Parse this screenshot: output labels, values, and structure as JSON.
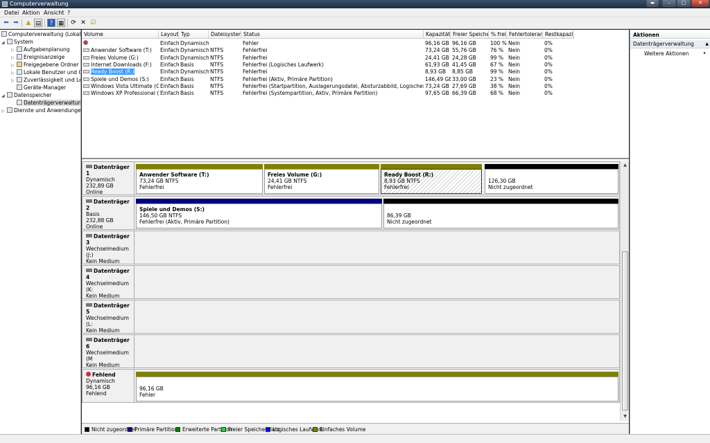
{
  "window": {
    "title": "Computerverwaltung"
  },
  "menu": [
    "Datei",
    "Aktion",
    "Ansicht",
    "?"
  ],
  "tree": {
    "root": "Computerverwaltung (Lokal)",
    "system": "System",
    "system_items": [
      "Aufgabenplanung",
      "Ereignisanzeige",
      "Freigegebene Ordner",
      "Lokale Benutzer und Gr",
      "Zuverlässigkeit und Leis",
      "Geräte-Manager"
    ],
    "storage": "Datenspeicher",
    "storage_items": [
      "Datenträgerverwaltung"
    ],
    "services": "Dienste und Anwendungen"
  },
  "volumes": {
    "columns": [
      "Volume",
      "Layout",
      "Typ",
      "Dateisystem",
      "Status",
      "Kapazität",
      "Freier Speicher",
      "% frei",
      "Fehlertoleranz",
      "Restkapazität"
    ],
    "rows": [
      {
        "name": "",
        "layout": "Einfach",
        "type": "Dynamisch",
        "fs": "",
        "status": "Fehler",
        "capacity": "96,16 GB",
        "free": "96,16 GB",
        "pct": "100 %",
        "fault": "Nein",
        "overhead": "0%",
        "icon": "error"
      },
      {
        "name": "Anwender Software (T:)",
        "layout": "Einfach",
        "type": "Dynamisch",
        "fs": "NTFS",
        "status": "Fehlerfrei",
        "capacity": "73,24 GB",
        "free": "55,76 GB",
        "pct": "76 %",
        "fault": "Nein",
        "overhead": "0%",
        "icon": "drive"
      },
      {
        "name": "Freies Volume (G:)",
        "layout": "Einfach",
        "type": "Dynamisch",
        "fs": "NTFS",
        "status": "Fehlerfrei",
        "capacity": "24,41 GB",
        "free": "24,28 GB",
        "pct": "99 %",
        "fault": "Nein",
        "overhead": "0%",
        "icon": "drive"
      },
      {
        "name": "Internet Downloads (F:)",
        "layout": "Einfach",
        "type": "Basis",
        "fs": "NTFS",
        "status": "Fehlerfrei (Logisches Laufwerk)",
        "capacity": "61,93 GB",
        "free": "41,45 GB",
        "pct": "67 %",
        "fault": "Nein",
        "overhead": "0%",
        "icon": "drive"
      },
      {
        "name": "Ready Boost (R:)",
        "layout": "Einfach",
        "type": "Dynamisch",
        "fs": "NTFS",
        "status": "Fehlerfrei",
        "capacity": "8,93 GB",
        "free": "8,85 GB",
        "pct": "99 %",
        "fault": "Nein",
        "overhead": "0%",
        "icon": "drive",
        "selected": true
      },
      {
        "name": "Spiele und Demos (S:)",
        "layout": "Einfach",
        "type": "Basis",
        "fs": "NTFS",
        "status": "Fehlerfrei (Aktiv, Primäre Partition)",
        "capacity": "146,49 GB",
        "free": "33,00 GB",
        "pct": "23 %",
        "fault": "Nein",
        "overhead": "0%",
        "icon": "drive"
      },
      {
        "name": "Windows Vista Ultimate (C:)",
        "layout": "Einfach",
        "type": "Basis",
        "fs": "NTFS",
        "status": "Fehlerfrei (Startpartition, Auslagerungsdatei, Absturzabbild, Logisches Laufwerk)",
        "capacity": "73,24 GB",
        "free": "27,69 GB",
        "pct": "38 %",
        "fault": "Nein",
        "overhead": "0%",
        "icon": "drive"
      },
      {
        "name": "Windows XP Professional (O:)",
        "layout": "Einfach",
        "type": "Basis",
        "fs": "NTFS",
        "status": "Fehlerfrei (Systempartition, Aktiv, Primäre Partition)",
        "capacity": "97,65 GB",
        "free": "66,39 GB",
        "pct": "68 %",
        "fault": "Nein",
        "overhead": "0%",
        "icon": "drive"
      }
    ]
  },
  "disks": [
    {
      "name": "Datenträger 1",
      "lines": [
        "Dynamisch",
        "232,89 GB",
        "Online"
      ],
      "icon": "disk",
      "partitions": [
        {
          "name": "Anwender Software (T:)",
          "size": "73,24 GB NTFS",
          "status": "Fehlerfrei",
          "bar_color": "#808000",
          "hatch": false,
          "selected": false
        },
        {
          "name": "Freies Volume (G:)",
          "size": "24,41 GB NTFS",
          "status": "Fehlerfrei",
          "bar_color": "#808000",
          "hatch": false,
          "selected": false
        },
        {
          "name": "Ready Boost (R:)",
          "size": "8,93 GB NTFS",
          "status": "Fehlerfrei",
          "bar_color": "#808000",
          "hatch": true,
          "selected": true
        },
        {
          "name": "",
          "size": "126,30 GB",
          "status": "Nicht zugeordnet",
          "bar_color": "#000000",
          "hatch": false,
          "selected": false
        }
      ]
    },
    {
      "name": "Datenträger 2",
      "lines": [
        "Basis",
        "232,88 GB",
        "Online"
      ],
      "icon": "disk",
      "partitions": [
        {
          "name": "Spiele und Demos (S:)",
          "size": "146,50 GB NTFS",
          "status": "Fehlerfrei (Aktiv, Primäre Partition)",
          "bar_color": "#000080",
          "hatch": false,
          "selected": false
        },
        {
          "name": "",
          "size": "86,39 GB",
          "status": "Nicht zugeordnet",
          "bar_color": "#000000",
          "hatch": false,
          "selected": false
        }
      ]
    },
    {
      "name": "Datenträger 3",
      "lines": [
        "Wechselmedium (J:)",
        "",
        "Kein Medium"
      ],
      "icon": "disk",
      "partitions": []
    },
    {
      "name": "Datenträger 4",
      "lines": [
        "Wechselmedium (K:",
        "",
        "Kein Medium"
      ],
      "icon": "disk",
      "partitions": []
    },
    {
      "name": "Datenträger 5",
      "lines": [
        "Wechselmedium (L:",
        "",
        "Kein Medium"
      ],
      "icon": "disk",
      "partitions": []
    },
    {
      "name": "Datenträger 6",
      "lines": [
        "Wechselmedium (M",
        "",
        "Kein Medium"
      ],
      "icon": "disk",
      "partitions": []
    },
    {
      "name": "Fehlend",
      "lines": [
        "Dynamisch",
        "96,16 GB",
        "Fehlend"
      ],
      "icon": "error",
      "partitions": [
        {
          "name": "",
          "size": "96,16 GB",
          "status": "Fehler",
          "bar_color": "#808000",
          "hatch": false,
          "selected": false
        }
      ]
    }
  ],
  "legend": [
    {
      "label": "Nicht zugeordnet",
      "color": "#000000"
    },
    {
      "label": "Primäre Partition",
      "color": "#000080"
    },
    {
      "label": "Erweiterte Partition",
      "color": "#008000"
    },
    {
      "label": "Freier Speicherplatz",
      "color": "#33cc33"
    },
    {
      "label": "Logisches Laufwerk",
      "color": "#0000ff"
    },
    {
      "label": "Einfaches Volume",
      "color": "#808000"
    }
  ],
  "actions": {
    "header": "Aktionen",
    "section": "Datenträgerverwaltung",
    "item": "Weitere Aktionen"
  }
}
